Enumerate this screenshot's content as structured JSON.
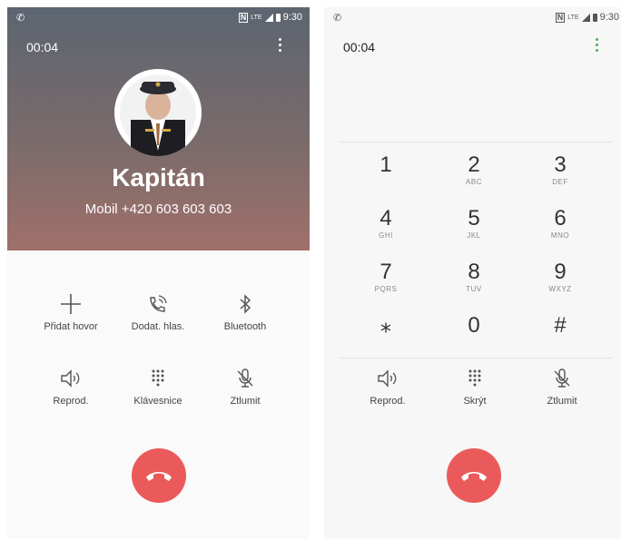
{
  "left": {
    "statusbar": {
      "time": "9:30",
      "lte": "LTE"
    },
    "timer": "00:04",
    "contact": {
      "name": "Kapitán",
      "number": "Mobil  +420 603 603 603"
    },
    "controls": [
      {
        "label": "Přidat hovor",
        "icon": "add-call-icon"
      },
      {
        "label": "Dodat. hlas.",
        "icon": "extra-volume-icon"
      },
      {
        "label": "Bluetooth",
        "icon": "bluetooth-icon"
      },
      {
        "label": "Reprod.",
        "icon": "speaker-icon"
      },
      {
        "label": "Klávesnice",
        "icon": "keypad-icon"
      },
      {
        "label": "Ztlumit",
        "icon": "mute-icon"
      }
    ],
    "end_call_color": "#eb5a5a"
  },
  "right": {
    "statusbar": {
      "time": "9:30",
      "lte": "LTE"
    },
    "timer": "00:04",
    "keypad": [
      {
        "digit": "1",
        "letters": ""
      },
      {
        "digit": "2",
        "letters": "ABC"
      },
      {
        "digit": "3",
        "letters": "DEF"
      },
      {
        "digit": "4",
        "letters": "GHI"
      },
      {
        "digit": "5",
        "letters": "JKL"
      },
      {
        "digit": "6",
        "letters": "MNO"
      },
      {
        "digit": "7",
        "letters": "PQRS"
      },
      {
        "digit": "8",
        "letters": "TUV"
      },
      {
        "digit": "9",
        "letters": "WXYZ"
      },
      {
        "digit": "⁎",
        "letters": ""
      },
      {
        "digit": "0",
        "letters": ""
      },
      {
        "digit": "#",
        "letters": ""
      }
    ],
    "controls": [
      {
        "label": "Reprod.",
        "icon": "speaker-icon"
      },
      {
        "label": "Skrýt",
        "icon": "keypad-icon"
      },
      {
        "label": "Ztlumit",
        "icon": "mute-icon"
      }
    ],
    "accent_color": "#4caf50"
  }
}
